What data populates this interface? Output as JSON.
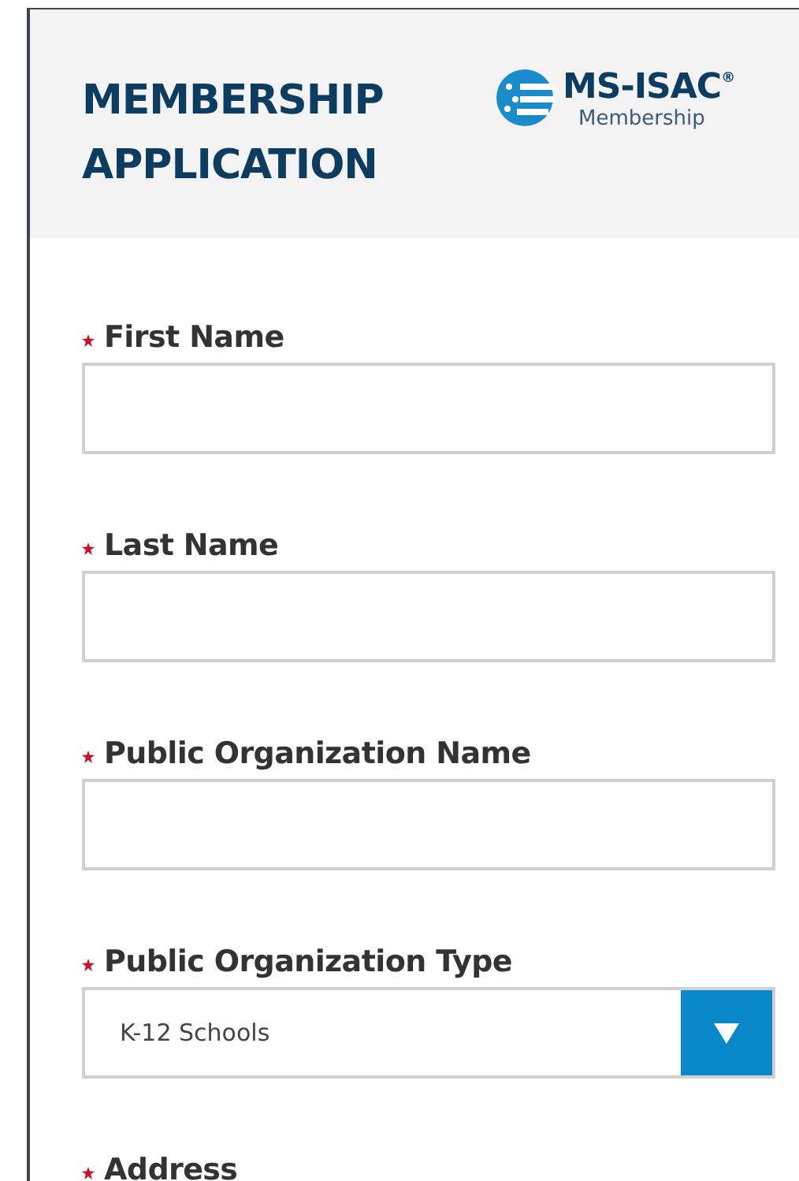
{
  "header": {
    "title_lines": [
      "MEMBERSHIP",
      "APPLICATION"
    ],
    "logo": {
      "name": "MS-ISAC",
      "mark": "®",
      "subtitle": "Membership"
    }
  },
  "fields": [
    {
      "label": "First Name",
      "required": true,
      "kind": "text"
    },
    {
      "label": "Last Name",
      "required": true,
      "kind": "text"
    },
    {
      "label": "Public Organization Name",
      "required": true,
      "kind": "text"
    },
    {
      "label": "Public Organization Type",
      "required": true,
      "kind": "select",
      "value": "K-12 Schools"
    },
    {
      "label": "Address",
      "required": true,
      "kind": "label"
    }
  ]
}
